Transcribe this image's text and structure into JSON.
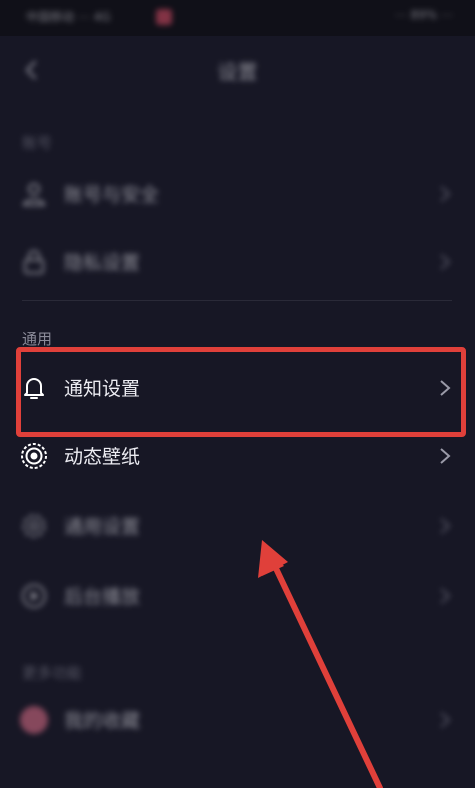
{
  "status_bar": {
    "left_text": "中国移动 ⋯ 4G",
    "right_text": "⋯ 89% ⋯"
  },
  "header": {
    "title": "设置"
  },
  "sections": {
    "account_label": "账号",
    "general_label": "通用",
    "other_label": "更多功能"
  },
  "rows": {
    "account_security": "账号与安全",
    "privacy": "隐私设置",
    "notification": "通知设置",
    "live_wallpaper": "动态壁纸",
    "general_settings": "通用设置",
    "background_play": "后台播放",
    "favorites": "我的收藏"
  },
  "colors": {
    "background": "#171725",
    "highlight_border": "#e0403a",
    "arrow": "#e0403a"
  }
}
